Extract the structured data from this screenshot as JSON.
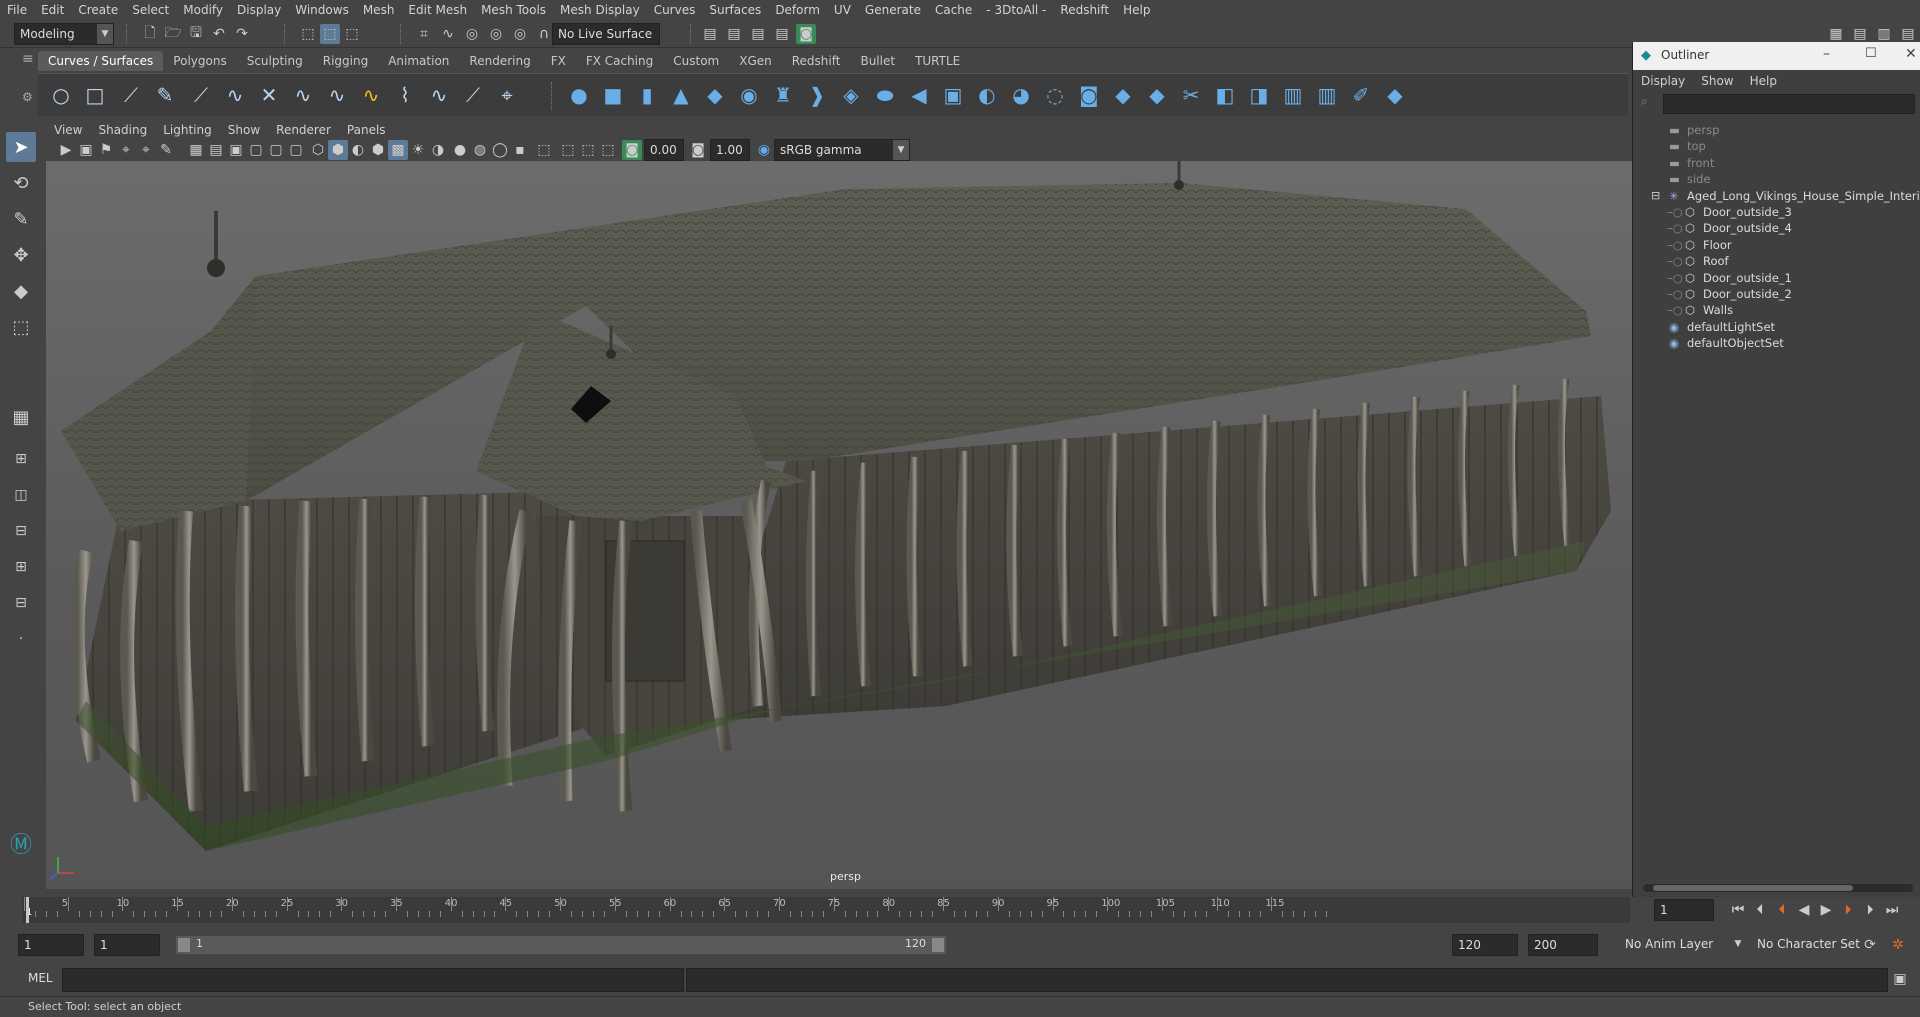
{
  "menubar": {
    "items": [
      "File",
      "Edit",
      "Create",
      "Select",
      "Modify",
      "Display",
      "Windows",
      "Mesh",
      "Edit Mesh",
      "Mesh Tools",
      "Mesh Display",
      "Curves",
      "Surfaces",
      "Deform",
      "UV",
      "Generate",
      "Cache",
      "- 3DtoAll -",
      "Redshift",
      "Help"
    ]
  },
  "statusline": {
    "mode": "Modeling",
    "live_surface": "No Live Surface"
  },
  "shelf": {
    "tabs": [
      "Curves / Surfaces",
      "Polygons",
      "Sculpting",
      "Rigging",
      "Animation",
      "Rendering",
      "FX",
      "FX Caching",
      "Custom",
      "XGen",
      "Redshift",
      "Bullet",
      "TURTLE"
    ],
    "active_tab": "Curves / Surfaces"
  },
  "viewport": {
    "menu": [
      "View",
      "Shading",
      "Lighting",
      "Show",
      "Renderer",
      "Panels"
    ],
    "exposure": "0.00",
    "gamma": "1.00",
    "color_space": "sRGB gamma",
    "camera_label": "persp"
  },
  "outliner": {
    "title": "Outliner",
    "menu": [
      "Display",
      "Show",
      "Help"
    ],
    "rows": [
      {
        "label": "persp",
        "kind": "camera",
        "indent": 1
      },
      {
        "label": "top",
        "kind": "camera",
        "indent": 1
      },
      {
        "label": "front",
        "kind": "camera",
        "indent": 1
      },
      {
        "label": "side",
        "kind": "camera",
        "indent": 1
      },
      {
        "label": "Aged_Long_Vikings_House_Simple_Interior",
        "kind": "group",
        "indent": 1
      },
      {
        "label": "Door_outside_3",
        "kind": "mesh",
        "indent": 2
      },
      {
        "label": "Door_outside_4",
        "kind": "mesh",
        "indent": 2
      },
      {
        "label": "Floor",
        "kind": "mesh",
        "indent": 2
      },
      {
        "label": "Roof",
        "kind": "mesh",
        "indent": 2
      },
      {
        "label": "Door_outside_1",
        "kind": "mesh",
        "indent": 2
      },
      {
        "label": "Door_outside_2",
        "kind": "mesh",
        "indent": 2
      },
      {
        "label": "Walls",
        "kind": "mesh",
        "indent": 2
      },
      {
        "label": "defaultLightSet",
        "kind": "set",
        "indent": 1
      },
      {
        "label": "defaultObjectSet",
        "kind": "set",
        "indent": 1
      }
    ]
  },
  "timeline": {
    "ticks": [
      "1",
      "5",
      "10",
      "15",
      "20",
      "25",
      "30",
      "35",
      "40",
      "45",
      "50",
      "55",
      "60",
      "65",
      "70",
      "75",
      "80",
      "85",
      "90",
      "95",
      "100",
      "105",
      "110",
      "115"
    ],
    "current_frame": "1"
  },
  "range": {
    "start": "1",
    "playback_start": "1",
    "slider_start": "1",
    "slider_end": "120",
    "playback_end": "120",
    "end": "200",
    "anim_layer": "No Anim Layer",
    "character_set": "No Character Set"
  },
  "command": {
    "lang": "MEL"
  },
  "helpline": {
    "text": "Select Tool: select an object"
  }
}
